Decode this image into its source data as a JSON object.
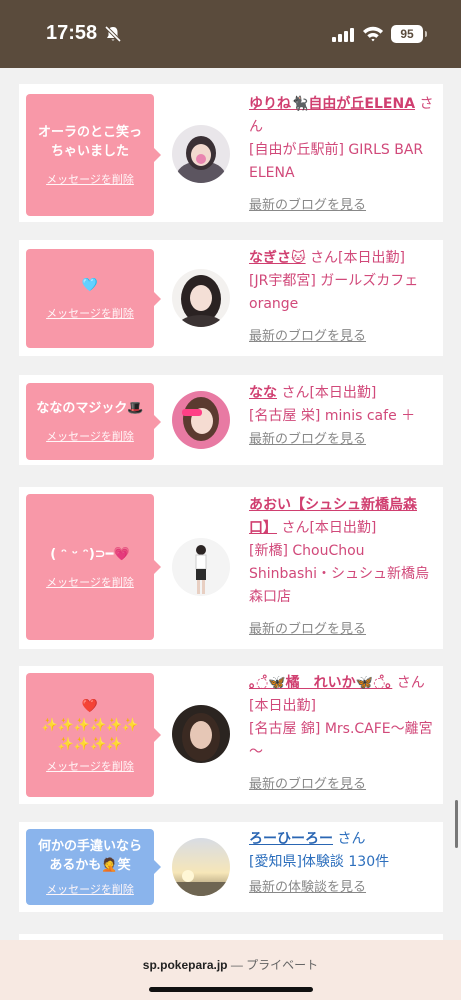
{
  "status_bar": {
    "time": "17:58",
    "battery": "95"
  },
  "cards": [
    {
      "bubble_text": "オーラのとこ笑っ\nちゃいました",
      "delete_label": "メッセージを削除",
      "name": "ゆりね🐈‍⬛自由が丘ELENA",
      "san": "さん",
      "shop": "[自由が丘駅前] GIRLS BAR ELENA",
      "link": "最新のブログを見る"
    },
    {
      "bubble_text": "🩵",
      "delete_label": "メッセージを削除",
      "name": "なぎさ🐱",
      "san": "さん[本日出勤]",
      "shop": "[JR宇都宮] ガールズカフェorange",
      "link": "最新のブログを見る"
    },
    {
      "bubble_text": "ななのマジック🎩",
      "delete_label": "メッセージを削除",
      "name": "なな",
      "san": "さん[本日出勤]",
      "shop": "[名古屋 栄] minis cafe ＋",
      "link": "最新のブログを見る"
    },
    {
      "bubble_text": "( ᵔ ᵕ ᵔ)⊃━💗",
      "delete_label": "メッセージを削除",
      "name": "あおい【シュシュ新橋烏森口】",
      "san": "さん[本日出勤]",
      "shop": "[新橋] ChouChou Shinbashi・シュシュ新橋烏森口店",
      "link": "最新のブログを見る"
    },
    {
      "bubble_text": "❤️\n✨✨✨✨✨✨\n✨✨✨✨",
      "delete_label": "メッセージを削除",
      "name": "｡◌̊🦋橘　れいか🦋◌̊｡",
      "san": "さん[本日出勤]",
      "shop": "[名古屋 錦] Mrs.CAFE～離宮～",
      "link": "最新のブログを見る"
    },
    {
      "bubble_text": "何かの手違いなら\nあるかも🤦笑",
      "delete_label": "メッセージを削除",
      "name": "ろーひーろー",
      "san": "さん",
      "shop": "[愛知県]体験談 130件",
      "link": "最新の体験談を見る"
    }
  ],
  "browser": {
    "domain": "sp.pokepara.jp",
    "separator": " — ",
    "mode": "プライベート"
  },
  "colors": {
    "accent_pink": "#d03f70",
    "bubble_pink": "#f898a8",
    "bubble_blue": "#8ab4ec",
    "status_bar": "#5a4b3c"
  }
}
